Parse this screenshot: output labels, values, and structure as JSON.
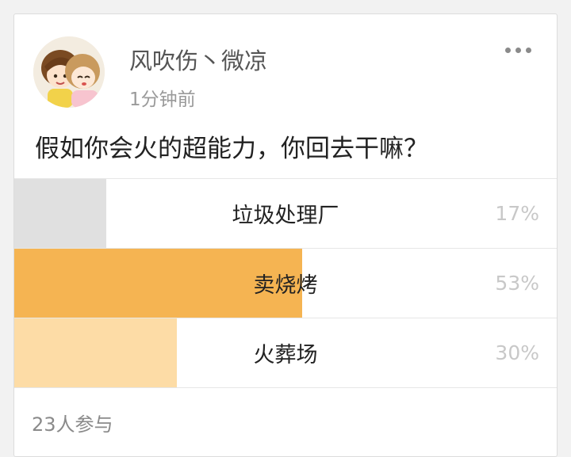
{
  "post": {
    "username": "风吹伤丶微凉",
    "time": "1分钟前",
    "question": "假如你会火的超能力，你回去干嘛？"
  },
  "poll": {
    "options": [
      {
        "label": "垃圾处理厂",
        "percent_text": "17%",
        "fill_fraction": 0.17,
        "color": "#e0e0e0"
      },
      {
        "label": "卖烧烤",
        "percent_text": "53%",
        "fill_fraction": 0.53,
        "color": "#f5b452"
      },
      {
        "label": "火葬场",
        "percent_text": "30%",
        "fill_fraction": 0.3,
        "color": "#fddca6"
      }
    ],
    "participants": "23人参与"
  },
  "icons": {
    "more": "more-dots-icon",
    "avatar": "anime-avatar"
  }
}
